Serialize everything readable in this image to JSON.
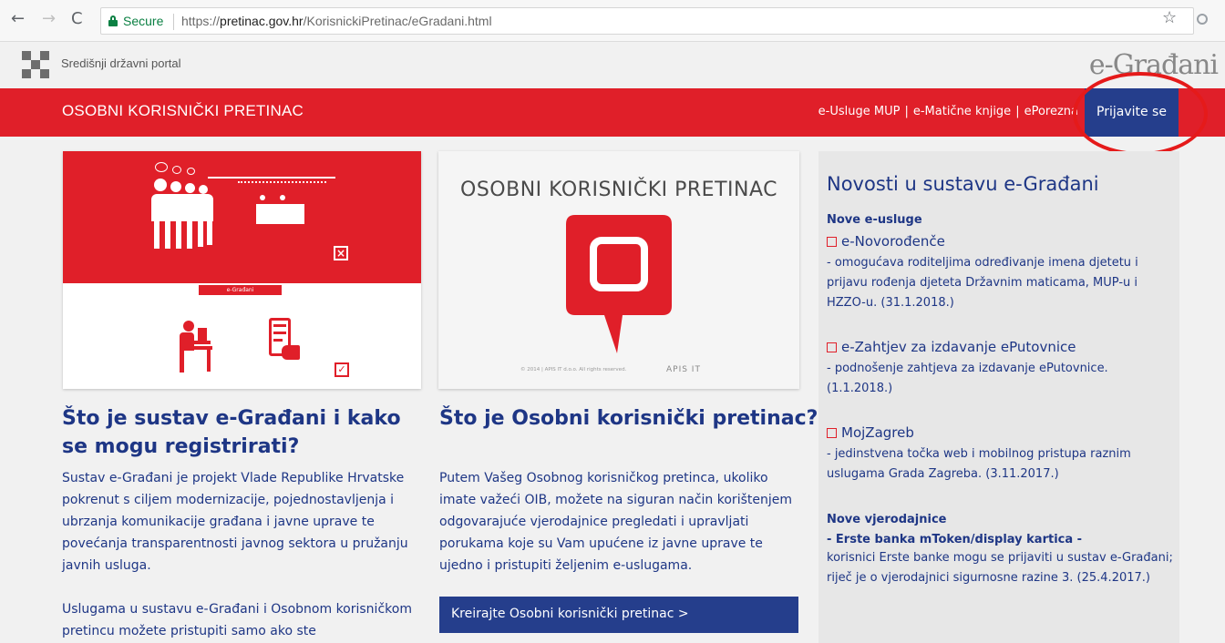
{
  "browser": {
    "secure_label": "Secure",
    "url_scheme": "https://",
    "url_host": "pretinac.gov.hr",
    "url_path": "/KorisnickiPretinac/eGradani.html"
  },
  "portal": {
    "name": "Središnji državni portal",
    "logo_text": "e-Građani"
  },
  "header": {
    "title": "OSOBNI KORISNIČKI PRETINAC",
    "links": [
      "e-Usluge MUP",
      "e-Matične knjige",
      "ePorezna"
    ],
    "login_label": "Prijavite se"
  },
  "col1": {
    "illustration_label": "e-Građani",
    "title": "Što je sustav e-Građani i kako se mogu registrirati?",
    "para1": "Sustav e-Građani je projekt Vlade Republike Hrvatske pokrenut s ciljem modernizacije, pojednostavljenja i ubrzanja komunikacije građana i javne uprave te povećanja transparentnosti javnog sektora u pružanju javnih usluga.",
    "para2": "Uslugama u sustavu e-Građani i Osobnom korisničkom pretincu možete pristupiti samo ako ste"
  },
  "col2": {
    "image_title": "OSOBNI KORISNIČKI PRETINAC",
    "image_copyright": "© 2014 | APIS IT d.o.o. All rights reserved.",
    "image_brand": "APIS IT",
    "title": "Što je Osobni korisnički pretinac?",
    "para": "Putem Vašeg Osobnog korisničkog pretinca, ukoliko imate važeći OIB, možete na siguran način korištenjem odgovarajuće vjerodajnice pregledati i upravljati porukama koje su Vam upućene iz javne uprave te ujedno i pristupiti željenim e-uslugama.",
    "cta": "Kreirajte Osobni korisnički pretinac >"
  },
  "news": {
    "title": "Novosti u sustavu e-Građani",
    "section1": "Nove e-usluge",
    "items": [
      {
        "title": "e-Novorođenče",
        "desc": "- omogućava roditeljima određivanje imena djetetu i prijavu rođenja djeteta Državnim maticama, MUP-u i HZZO-u. (31.1.2018.)"
      },
      {
        "title": "e-Zahtjev za izdavanje ePutovnice",
        "desc": "- podnošenje zahtjeva za izdavanje ePutovnice. (1.1.2018.)"
      },
      {
        "title": "MojZagreb",
        "desc": "- jedinstvena točka web i mobilnog pristupa raznim uslugama Grada Zagreba. (3.11.2017.)"
      }
    ],
    "section2": "Nove vjerodajnice",
    "cred_title": "- Erste banka mToken/display kartica -",
    "cred_desc": "korisnici Erste banke mogu se prijaviti u sustav e-Građani; riječ je o vjerodajnici sigurnosne razine 3. (25.4.2017.)"
  }
}
